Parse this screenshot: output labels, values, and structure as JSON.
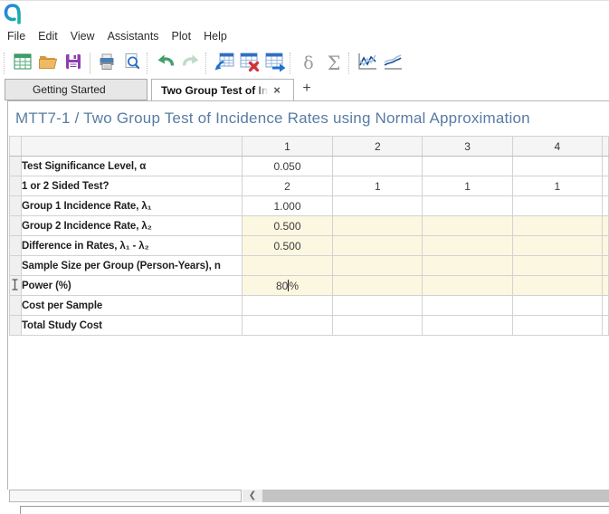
{
  "menu": {
    "items": [
      "File",
      "Edit",
      "View",
      "Assistants",
      "Plot",
      "Help"
    ]
  },
  "toolbar": {
    "delta_symbol": "δ",
    "sigma_symbol": "Σ"
  },
  "tabs": {
    "getting_started_label": "Getting Started",
    "active_label": "Two Group Test of Inci",
    "close_glyph": "×",
    "add_glyph": "+"
  },
  "main": {
    "title": "MTT7-1 / Two Group Test of Incidence Rates using Normal Approximation"
  },
  "spreadsheet": {
    "column_headers": [
      "1",
      "2",
      "3",
      "4"
    ],
    "rows": [
      {
        "label": "Test Significance Level, α",
        "values": [
          "0.050",
          "",
          "",
          ""
        ]
      },
      {
        "label": "1 or 2 Sided Test?",
        "values": [
          "2",
          "1",
          "1",
          "1"
        ]
      },
      {
        "label": "Group 1 Incidence Rate, λ₁",
        "values": [
          "1.000",
          "",
          "",
          ""
        ]
      },
      {
        "label": "Group 2 Incidence Rate, λ₂",
        "values": [
          "0.500",
          "",
          "",
          ""
        ]
      },
      {
        "label": "Difference in Rates, λ₁ - λ₂",
        "values": [
          "0.500",
          "",
          "",
          ""
        ]
      },
      {
        "label": "Sample Size per Group (Person-Years), n",
        "values": [
          "",
          "",
          "",
          ""
        ]
      },
      {
        "label": "Power (%)",
        "values": [
          "",
          "",
          "",
          ""
        ]
      },
      {
        "label": "Cost per Sample",
        "values": [
          "",
          "",
          "",
          ""
        ]
      },
      {
        "label": "Total Study Cost",
        "values": [
          "",
          "",
          "",
          ""
        ]
      }
    ],
    "editing_cell": {
      "row_label": "Power (%)",
      "text_before_caret": "80",
      "text_after_caret": "%"
    }
  },
  "scrollbar": {
    "left_arrow_glyph": "❮"
  },
  "colors": {
    "highlight_cell_bg": "#fbf7e1",
    "title_text": "#587ca4",
    "accent_blue": "#2f6fc4",
    "logo_gradient_start": "#2a7de1",
    "logo_gradient_end": "#12b8a6"
  }
}
